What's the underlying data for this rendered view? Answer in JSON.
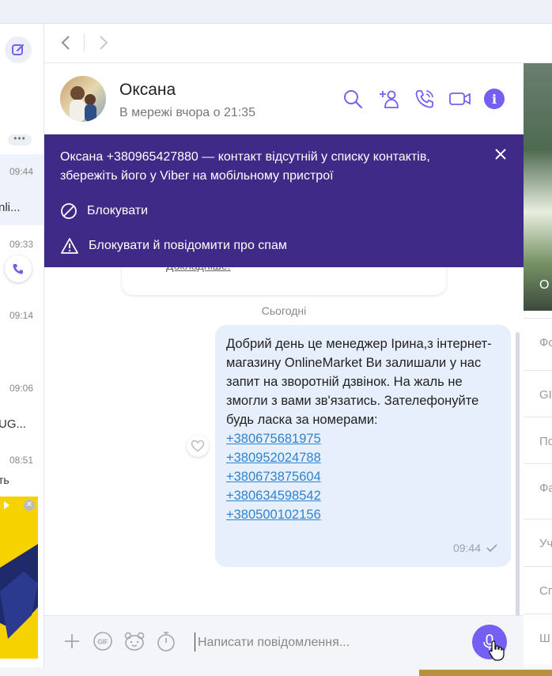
{
  "left_list": {
    "items": [
      {
        "time": "09:44"
      },
      {
        "time": "09:33"
      },
      {
        "time": "09:14"
      },
      {
        "time": "09:06"
      },
      {
        "time": "08:51"
      }
    ],
    "previews": [
      "nli...",
      "UG...",
      "ть"
    ],
    "dots_label": "•••"
  },
  "chat": {
    "name": "Оксана",
    "status": "В мережі вчора о 21:35"
  },
  "banner": {
    "message": "Оксана +380965427880 — контакт відсутній у списку контактів, збережіть його у Viber на мобільному пристрої",
    "block_label": "Блокувати",
    "block_report_label": "Блокувати й повідомити про спам"
  },
  "messages": {
    "old_link": "Докладніше.",
    "day_divider": "Сьогодні",
    "text": "Добрий день це менеджер Ірина,з інтернет-магазину OnlineMarket Ви залишали у нас запит на зворотній дзвінок. На жаль не змогли з вами зв'язатись. Зателефонуйте будь ласка за номерами:",
    "phones": [
      "+380675681975",
      "+380952024788",
      "+380673875604",
      "+380634598542",
      "+380500102156"
    ],
    "time": "09:44"
  },
  "composer": {
    "placeholder": "Написати повідомлення..."
  },
  "right_panel": {
    "image_caption": "О",
    "items": [
      "Фо",
      "GI",
      "По",
      "Фа",
      "Уч",
      "Сп",
      "Ш"
    ]
  },
  "colors": {
    "accent": "#7360f2",
    "banner": "#3f2a87",
    "bubble": "#e8effc",
    "link": "#2e84d0"
  }
}
